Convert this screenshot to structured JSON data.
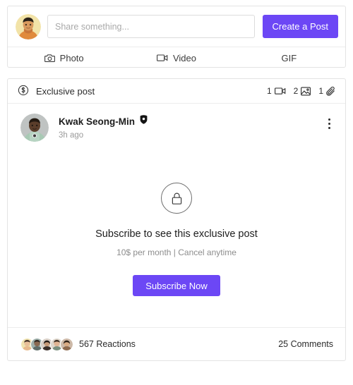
{
  "theme": {
    "accent": "#6c47f5",
    "card_border": "#e3e3e3",
    "divider": "#ececec",
    "text_primary": "#1d1d1d",
    "text_muted": "#9a9a9a",
    "page_background": "#ffffff"
  },
  "composer": {
    "avatar_name": "current-user-avatar",
    "input_placeholder": "Share something...",
    "input_value": "",
    "create_post_label": "Create a Post",
    "actions": [
      {
        "label": "Photo",
        "icon": "camera-icon"
      },
      {
        "label": "Video",
        "icon": "video-camera-icon"
      },
      {
        "label": "GIF",
        "icon": "none"
      }
    ]
  },
  "post": {
    "banner": {
      "icon": "dollar-circle-icon",
      "label": "Exclusive post",
      "counts": [
        {
          "value": "1",
          "icon": "video-camera-icon",
          "name": "video-count"
        },
        {
          "value": "2",
          "icon": "image-icon",
          "name": "image-count"
        },
        {
          "value": "1",
          "icon": "paperclip-icon",
          "name": "attachment-count"
        }
      ]
    },
    "author": {
      "name": "Kwak Seong-Min",
      "verified_badge": "verified-shield-icon",
      "timestamp": "3h ago"
    },
    "menu_icon": "more-options-icon",
    "locked": {
      "icon": "lock-icon",
      "title": "Subscribe to see this exclusive post",
      "subtitle": "10$ per month | Cancel anytime",
      "button_label": "Subscribe Now"
    },
    "footer": {
      "reactions_label": "567 Reactions",
      "reaction_avatar_count": 5,
      "comments_label": "25 Comments"
    }
  }
}
